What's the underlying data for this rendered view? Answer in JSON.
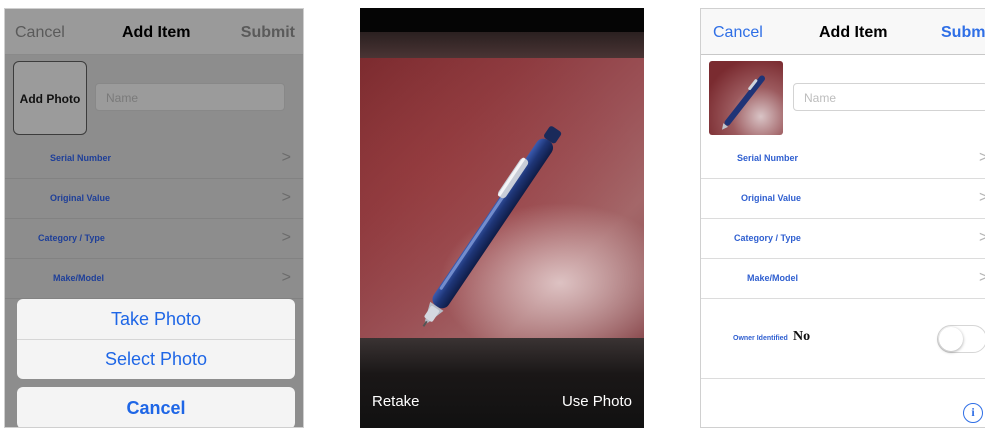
{
  "form": {
    "cancel_label": "Cancel",
    "title": "Add Item",
    "submit_label": "Submit",
    "add_photo_label": "Add Photo",
    "name_placeholder": "Name",
    "rows": [
      {
        "label": "Serial Number"
      },
      {
        "label": "Original Value"
      },
      {
        "label": "Category / Type"
      },
      {
        "label": "Make/Model"
      }
    ],
    "owner_label": "Owner Identified",
    "owner_value": "No",
    "owner_toggle_on": false,
    "info_glyph": "i",
    "chevron_glyph": ">"
  },
  "action_sheet": {
    "take_photo_label": "Take Photo",
    "select_photo_label": "Select Photo",
    "cancel_label": "Cancel"
  },
  "camera": {
    "retake_label": "Retake",
    "use_photo_label": "Use Photo"
  },
  "colors": {
    "ios_blue": "#2f6fe6",
    "label_blue": "#2f5fd0",
    "sheet_blue": "#1e66e6",
    "dim_overlay": "#8d8d8d"
  },
  "icons": [
    "chevron-right-icon",
    "info-icon",
    "pen-photo",
    "toggle-switch"
  ]
}
